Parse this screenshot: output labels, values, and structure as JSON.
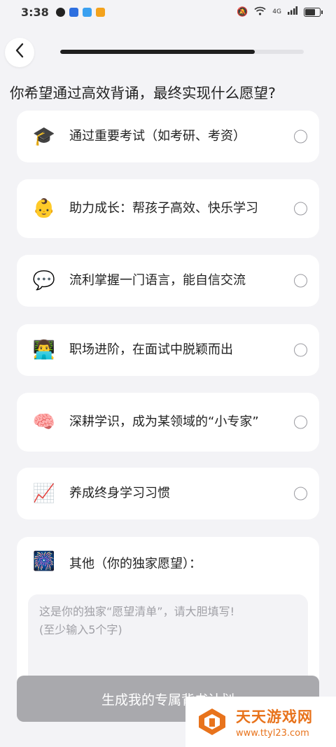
{
  "status_bar": {
    "time": "3:38",
    "network": "4G",
    "icons": [
      "penguin-app-icon",
      "shield-app-icon",
      "cloud-app-icon",
      "video-app-icon",
      "mute-icon",
      "wifi-icon",
      "signal-icon",
      "battery-icon"
    ],
    "battery_level": 0.85
  },
  "header": {
    "back_icon": "chevron-left-icon",
    "progress": 0.8
  },
  "question": "你希望通过高效背诵，最终实现什么愿望?",
  "options": [
    {
      "emoji": "🎓",
      "icon": "graduation-cap-icon",
      "label": "通过重要考试（如考研、考资）"
    },
    {
      "emoji": "👶",
      "icon": "baby-icon",
      "label": "助力成长：帮孩子高效、快乐学习"
    },
    {
      "emoji": "💬",
      "icon": "speech-bubble-icon",
      "label": "流利掌握一门语言，能自信交流"
    },
    {
      "emoji": "👨‍💻",
      "icon": "office-worker-icon",
      "label": "职场进阶，在面试中脱颖而出"
    },
    {
      "emoji": "🧠",
      "icon": "brain-icon",
      "label": "深耕学识，成为某领域的“小专家”"
    },
    {
      "emoji": "📈",
      "icon": "chart-up-icon",
      "label": "养成终身学习习惯"
    }
  ],
  "other": {
    "emoji": "🎆",
    "icon": "fireworks-icon",
    "label": "其他（你的独家愿望）：",
    "placeholder_line1": "这是你的独家“愿望清单”，请大胆填写!",
    "placeholder_line2": "(至少输入5个字)"
  },
  "submit_label": "生成我的专属背书计划",
  "watermark": {
    "title": "天天游戏网",
    "url": "www.ttyl23.com"
  },
  "colors": {
    "background": "#f3f3f6",
    "card": "#ffffff",
    "button_disabled": "#a9a9ad",
    "progress": "#1e1e1e",
    "watermark": "#e8731c"
  }
}
